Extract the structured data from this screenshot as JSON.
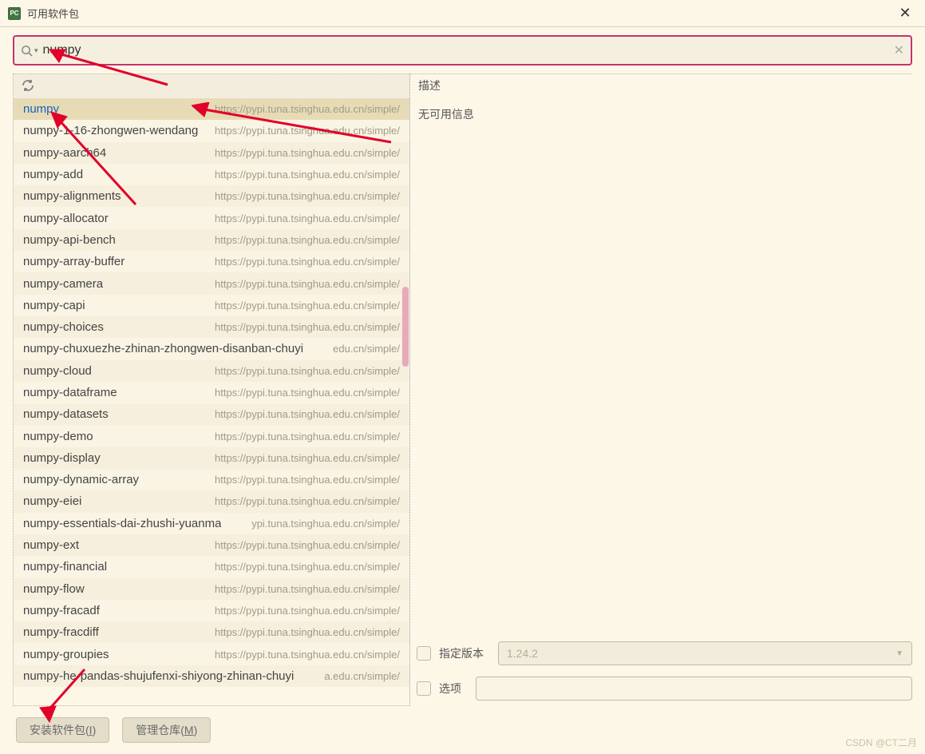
{
  "window": {
    "title": "可用软件包",
    "app_icon_label": "PC"
  },
  "search": {
    "value": "numpy",
    "clear_title": "清除"
  },
  "package_url_default": "https://pypi.tuna.tsinghua.edu.cn/simple/",
  "packages": [
    {
      "name": "numpy",
      "url": "https://pypi.tuna.tsinghua.edu.cn/simple/",
      "selected": true
    },
    {
      "name": "numpy-1-16-zhongwen-wendang",
      "url": "https://pypi.tuna.tsinghua.edu.cn/simple/"
    },
    {
      "name": "numpy-aarch64",
      "url": "https://pypi.tuna.tsinghua.edu.cn/simple/"
    },
    {
      "name": "numpy-add",
      "url": "https://pypi.tuna.tsinghua.edu.cn/simple/"
    },
    {
      "name": "numpy-alignments",
      "url": "https://pypi.tuna.tsinghua.edu.cn/simple/"
    },
    {
      "name": "numpy-allocator",
      "url": "https://pypi.tuna.tsinghua.edu.cn/simple/"
    },
    {
      "name": "numpy-api-bench",
      "url": "https://pypi.tuna.tsinghua.edu.cn/simple/"
    },
    {
      "name": "numpy-array-buffer",
      "url": "https://pypi.tuna.tsinghua.edu.cn/simple/"
    },
    {
      "name": "numpy-camera",
      "url": "https://pypi.tuna.tsinghua.edu.cn/simple/"
    },
    {
      "name": "numpy-capi",
      "url": "https://pypi.tuna.tsinghua.edu.cn/simple/"
    },
    {
      "name": "numpy-choices",
      "url": "https://pypi.tuna.tsinghua.edu.cn/simple/"
    },
    {
      "name": "numpy-chuxuezhe-zhinan-zhongwen-disanban-chuyi",
      "url": "edu.cn/simple/"
    },
    {
      "name": "numpy-cloud",
      "url": "https://pypi.tuna.tsinghua.edu.cn/simple/"
    },
    {
      "name": "numpy-dataframe",
      "url": "https://pypi.tuna.tsinghua.edu.cn/simple/"
    },
    {
      "name": "numpy-datasets",
      "url": "https://pypi.tuna.tsinghua.edu.cn/simple/"
    },
    {
      "name": "numpy-demo",
      "url": "https://pypi.tuna.tsinghua.edu.cn/simple/"
    },
    {
      "name": "numpy-display",
      "url": "https://pypi.tuna.tsinghua.edu.cn/simple/"
    },
    {
      "name": "numpy-dynamic-array",
      "url": "https://pypi.tuna.tsinghua.edu.cn/simple/"
    },
    {
      "name": "numpy-eiei",
      "url": "https://pypi.tuna.tsinghua.edu.cn/simple/"
    },
    {
      "name": "numpy-essentials-dai-zhushi-yuanma",
      "url": "ypi.tuna.tsinghua.edu.cn/simple/"
    },
    {
      "name": "numpy-ext",
      "url": "https://pypi.tuna.tsinghua.edu.cn/simple/"
    },
    {
      "name": "numpy-financial",
      "url": "https://pypi.tuna.tsinghua.edu.cn/simple/"
    },
    {
      "name": "numpy-flow",
      "url": "https://pypi.tuna.tsinghua.edu.cn/simple/"
    },
    {
      "name": "numpy-fracadf",
      "url": "https://pypi.tuna.tsinghua.edu.cn/simple/"
    },
    {
      "name": "numpy-fracdiff",
      "url": "https://pypi.tuna.tsinghua.edu.cn/simple/"
    },
    {
      "name": "numpy-groupies",
      "url": "https://pypi.tuna.tsinghua.edu.cn/simple/"
    },
    {
      "name": "numpy-he-pandas-shujufenxi-shiyong-zhinan-chuyi",
      "url": "a.edu.cn/simple/"
    }
  ],
  "detail": {
    "desc_label": "描述",
    "desc_body": "无可用信息",
    "version_label": "指定版本",
    "version_placeholder": "1.24.2",
    "options_label": "选项"
  },
  "footer": {
    "install_prefix": "安装软件包(",
    "install_key": "I",
    "install_suffix": ")",
    "manage_prefix": "管理仓库(",
    "manage_key": "M",
    "manage_suffix": ")"
  },
  "watermark": "CSDN @CT二月"
}
